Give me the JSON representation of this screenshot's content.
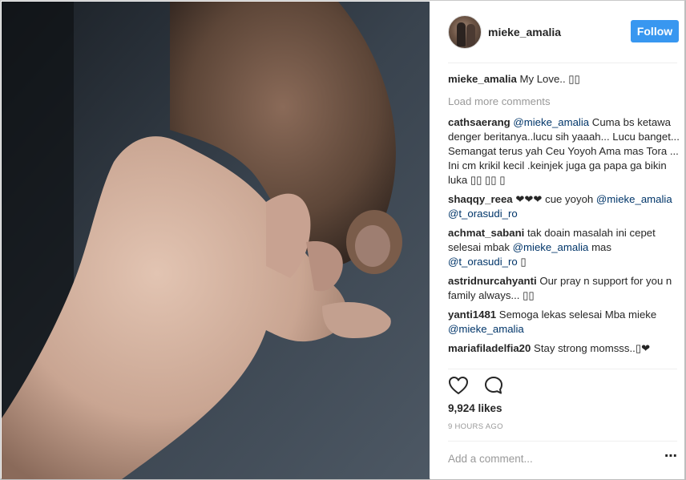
{
  "post": {
    "username": "mieke_amalia",
    "follow_label": "Follow"
  },
  "caption": {
    "username": "mieke_amalia",
    "text": "My Love.. ▯▯"
  },
  "load_more": "Load more comments",
  "comments": [
    {
      "username": "cathsaerang",
      "mention": "@mieke_amalia",
      "text": "Cuma bs ketawa denger beritanya..lucu sih yaaah... Lucu banget... Semangat terus yah Ceu Yoyoh Ama mas Tora ... Ini cm krikil kecil .keinjek juga ga papa ga bikin luka ▯▯ ▯▯ ▯"
    },
    {
      "username": "shaqqy_reea",
      "text_before": "❤❤❤ cue yoyoh",
      "mention1": "@mieke_amalia",
      "mention2": "@t_orasudi_ro"
    },
    {
      "username": "achmat_sabani",
      "text_before": "tak doain masalah ini cepet selesai mbak",
      "mention1": "@mieke_amalia",
      "text_middle": "mas",
      "mention2": "@t_orasudi_ro",
      "text_after": "▯"
    },
    {
      "username": "astridnurcahyanti",
      "text": "Our pray n support for you n family always... ▯▯"
    },
    {
      "username": "yanti1481",
      "text": "Semoga lekas selesai Mba mieke",
      "mention": "@mieke_amalia"
    },
    {
      "username": "mariafiladelfia20",
      "text": "Stay strong momsss..▯❤"
    }
  ],
  "likes": "9,924 likes",
  "timestamp": "9 HOURS AGO",
  "add_comment_placeholder": "Add a comment...",
  "icons": {
    "like": "heart-icon",
    "comment": "comment-bubble-icon",
    "more": "more-options-icon"
  },
  "colors": {
    "follow_button": "#3897f0",
    "mention": "#003569",
    "muted": "#999999"
  }
}
